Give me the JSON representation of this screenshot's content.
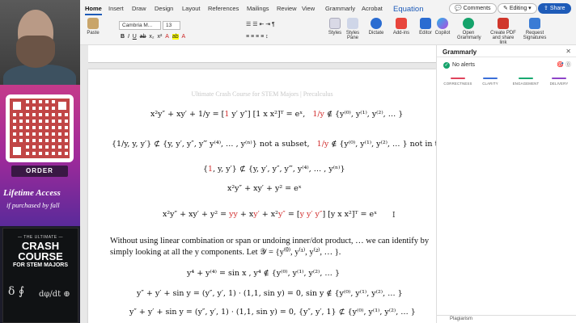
{
  "overlay": {
    "order_label": "ORDER",
    "lifetime_access": "Lifetime Access",
    "purchased": "if purchased by fall",
    "book_small": "— THE ULTIMATE —",
    "book_big_1": "CRASH COURSE",
    "book_mid": "FOR STEM MAJORS",
    "book_glyphs": "δ ∮",
    "book_glyphs2": "dφ/dt ⊕"
  },
  "ribbon_tabs": [
    "Home",
    "Insert",
    "Draw",
    "Design",
    "Layout",
    "References",
    "Mailings",
    "Review",
    "View",
    "Grammarly",
    "Acrobat",
    "Equation"
  ],
  "top_buttons": {
    "comments": "Comments",
    "editing": "Editing",
    "share": "Share"
  },
  "ribbon": {
    "paste": "Paste",
    "font_name": "Cambria M...",
    "font_size": "13",
    "styles": "Styles",
    "styles_pane": "Styles Pane",
    "dictate": "Dictate",
    "addins": "Add-ins",
    "editor": "Editor",
    "copilot": "Copilot",
    "open_grammarly": "Open Grammarly",
    "create_pdf": "Create PDF and share link",
    "request_sig": "Request Signatures"
  },
  "doc": {
    "header": "Ultimate Crash Course for STEM Majors | Precalculus",
    "eq1_a": "x²y″ + xy′ + ",
    "eq1_frac": "1/y",
    "eq1_b": " = [",
    "eq1_1": "1",
    "eq1_c": "  y′  y″] [1  x  x²]ᵀ = eˣ,",
    "eq1_d": "1/y",
    "eq1_e": " ∉ {y⁽⁰⁾, y⁽¹⁾, y⁽²⁾, … }",
    "eq2_a": "{1/y, y, y′} ⊄ {y, y′, y″, y‴ y⁽⁴⁾, … , y⁽ⁿ⁾}  not a subset,",
    "eq2_b": "1/y",
    "eq2_c": " ∉ {y⁽⁰⁾, y⁽¹⁾, y⁽²⁾, … }  not in the set",
    "eq3_a": "{",
    "eq3_1": "1",
    "eq3_b": ", y, y′} ⊄ {y, y′, y″, y‴, y⁽⁴⁾, … , y⁽ⁿ⁾}",
    "eq4": "x²y″ + xy′ + y² = eˣ",
    "eq5_a": "x²y″ + xy′ + y² = ",
    "eq5_b": "yy",
    "eq5_c": " + x",
    "eq5_d": "y′",
    "eq5_e": " + x²",
    "eq5_f": "y″",
    "eq5_g": " = [",
    "eq5_h": "y   y′   y″",
    "eq5_i": "] [y  x  x²]ᵀ = eˣ",
    "para": "Without using linear combination or span or undoing inner/dot product, … we can identify by simply looking at all the y components. Let 𝒴 = {y⁽⁰⁾, y⁽¹⁾, y⁽²⁾, … }.",
    "eq6": "y⁴ + y⁽⁴⁾ = sin x ,      y⁴ ∉ {y⁽⁰⁾, y⁽¹⁾, y⁽²⁾, … }",
    "eq7": "y″ + y′ + sin y = (y″, y′, 1) · (1,1, sin y) = 0,      sin y ∉ {y⁽⁰⁾, y⁽¹⁾, y⁽²⁾, … }",
    "eq8": "y″ + y′ + sin y = (y″, y′, 1) · (1,1, sin y) = 0,      {y″, y′, 1} ⊄ {y⁽⁰⁾, y⁽¹⁾, y⁽²⁾, … }"
  },
  "grammarly": {
    "title": "Grammarly",
    "alerts": "No alerts",
    "categories": [
      "CORRECTNESS",
      "CLARITY",
      "ENGAGEMENT",
      "DELIVERY"
    ],
    "colors": [
      "#e0435c",
      "#3b6fd8",
      "#19a971",
      "#8e44c8"
    ],
    "plagiarism": "Plagiarism"
  }
}
